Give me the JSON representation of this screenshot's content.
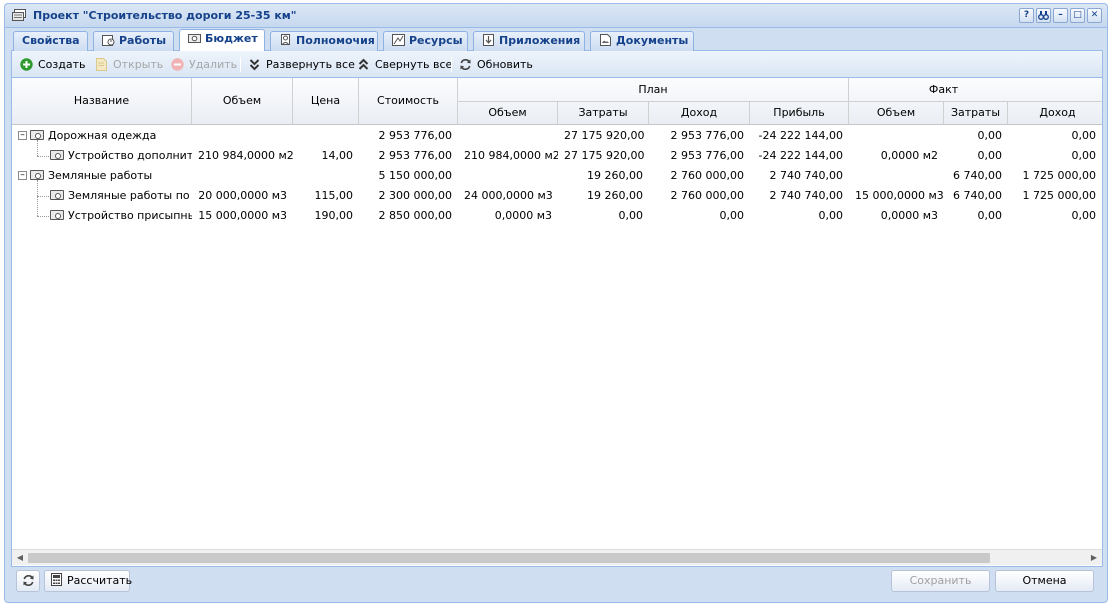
{
  "window": {
    "title": "Проект \"Строительство дороги 25-35 км\"",
    "tools": [
      "?",
      "☐",
      "–",
      "□",
      "✕"
    ]
  },
  "tabs": [
    {
      "label": "Свойства",
      "icon": ""
    },
    {
      "label": "Работы",
      "icon": "works-icon"
    },
    {
      "label": "Бюджет",
      "icon": "money-icon"
    },
    {
      "label": "Полномочия",
      "icon": "rights-icon"
    },
    {
      "label": "Ресурсы",
      "icon": "resources-icon"
    },
    {
      "label": "Приложения",
      "icon": "attachments-icon"
    },
    {
      "label": "Документы",
      "icon": "documents-icon"
    }
  ],
  "toolbar": {
    "create": "Создать",
    "open": "Открыть",
    "delete": "Удалить",
    "expand_all": "Развернуть все",
    "collapse_all": "Свернуть все",
    "refresh": "Обновить"
  },
  "columns": {
    "name": "Название",
    "volume": "Объем",
    "price": "Цена",
    "cost": "Стоимость",
    "plan": "План",
    "plan_volume": "Объем",
    "plan_costs": "Затраты",
    "plan_income": "Доход",
    "plan_profit": "Прибыль",
    "fact": "Факт",
    "fact_volume": "Объем",
    "fact_costs": "Затраты",
    "fact_income": "Доход"
  },
  "rows": [
    {
      "name": "Дорожная одежда",
      "volume": "",
      "price": "",
      "cost": "2 953 776,00",
      "plan_volume": "",
      "plan_costs": "27 175 920,00",
      "plan_income": "2 953 776,00",
      "plan_profit": "-24 222 144,00",
      "fact_volume": "",
      "fact_costs": "0,00",
      "fact_income": "0,00"
    },
    {
      "name": "Устройство дополните",
      "volume": "210 984,0000 м2",
      "price": "14,00",
      "cost": "2 953 776,00",
      "plan_volume": "210 984,0000 м2",
      "plan_costs": "27 175 920,00",
      "plan_income": "2 953 776,00",
      "plan_profit": "-24 222 144,00",
      "fact_volume": "0,0000 м2",
      "fact_costs": "0,00",
      "fact_income": "0,00"
    },
    {
      "name": "Земляные работы",
      "volume": "",
      "price": "",
      "cost": "5 150 000,00",
      "plan_volume": "",
      "plan_costs": "19 260,00",
      "plan_income": "2 760 000,00",
      "plan_profit": "2 740 740,00",
      "fact_volume": "",
      "fact_costs": "6 740,00",
      "fact_income": "1 725 000,00"
    },
    {
      "name": "Земляные работы по о",
      "volume": "20 000,0000 м3",
      "price": "115,00",
      "cost": "2 300 000,00",
      "plan_volume": "24 000,0000 м3",
      "plan_costs": "19 260,00",
      "plan_income": "2 760 000,00",
      "plan_profit": "2 740 740,00",
      "fact_volume": "15 000,0000 м3",
      "fact_costs": "6 740,00",
      "fact_income": "1 725 000,00"
    },
    {
      "name": "Устройство присыпны",
      "volume": "15 000,0000 м3",
      "price": "190,00",
      "cost": "2 850 000,00",
      "plan_volume": "0,0000 м3",
      "plan_costs": "0,00",
      "plan_income": "0,00",
      "plan_profit": "0,00",
      "fact_volume": "0,0000 м3",
      "fact_costs": "0,00",
      "fact_income": "0,00"
    }
  ],
  "footer": {
    "calculate": "Рассчитать",
    "save": "Сохранить",
    "cancel": "Отмена"
  }
}
